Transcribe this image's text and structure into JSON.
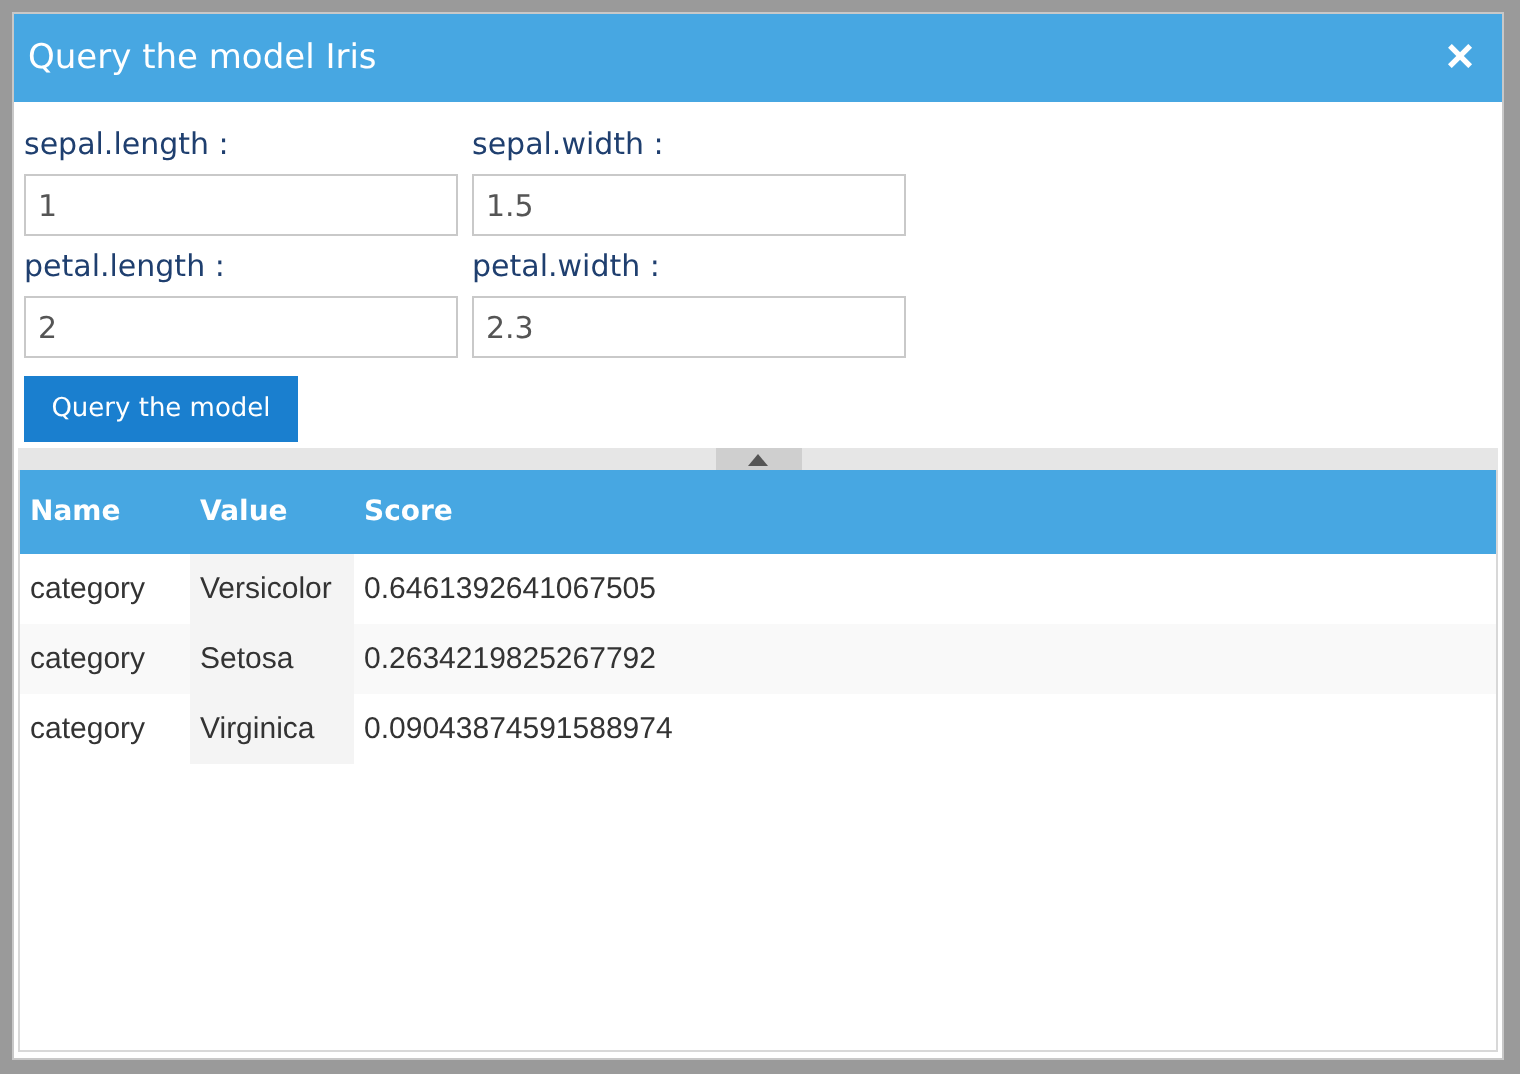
{
  "window": {
    "title": "Query the model Iris",
    "close": "×"
  },
  "fields": [
    {
      "label": "sepal.length :",
      "value": "1"
    },
    {
      "label": "sepal.width :",
      "value": "1.5"
    },
    {
      "label": "petal.length :",
      "value": "2"
    },
    {
      "label": "petal.width :",
      "value": "2.3"
    }
  ],
  "query_button": "Query the model",
  "table": {
    "columns": [
      "Name",
      "Value",
      "Score"
    ],
    "rows": [
      [
        "category",
        "Versicolor",
        "0.6461392641067505"
      ],
      [
        "category",
        "Setosa",
        "0.2634219825267792"
      ],
      [
        "category",
        "Virginica",
        "0.09043874591588974"
      ]
    ]
  }
}
